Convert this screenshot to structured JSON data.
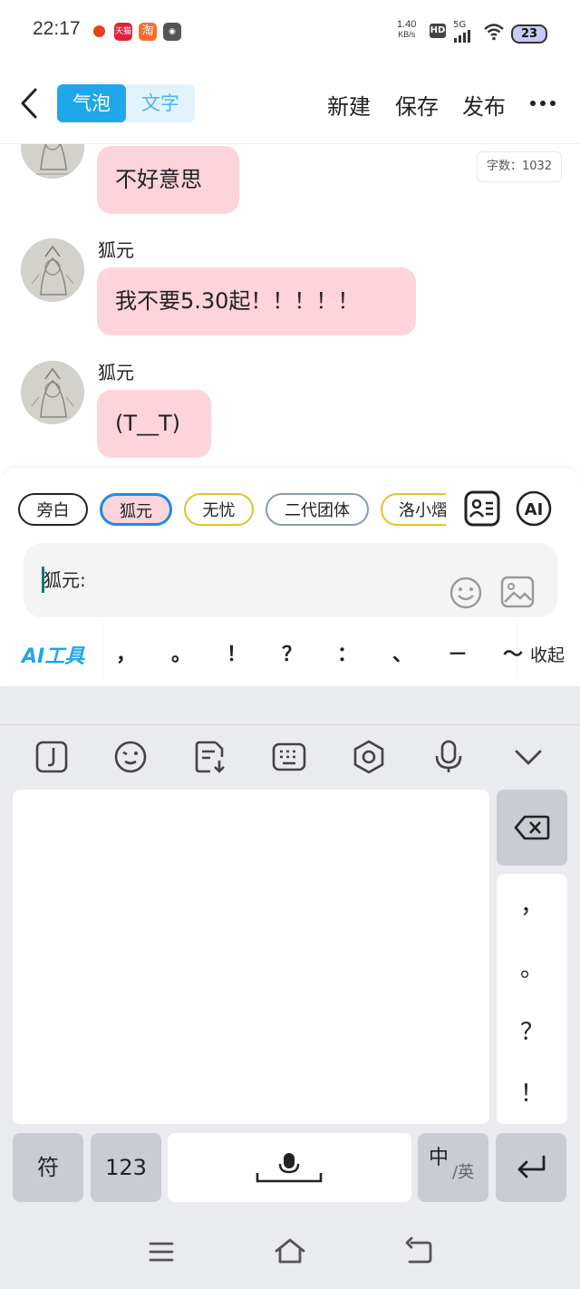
{
  "status_bar": {
    "time": "22:17",
    "apps": [
      "notification-dot",
      "tmall-app",
      "taobao-app",
      "robot-app"
    ],
    "tmall_label": "天猫",
    "taobao_label": "淘",
    "net_speed_value": "1.40",
    "net_speed_unit": "KB/s",
    "hd_label": "HD",
    "signal_label": "5G",
    "battery_level": "23"
  },
  "top_bar": {
    "back_icon": "chevron-left-icon",
    "mode_tabs": [
      "气泡",
      "文字"
    ],
    "selected_mode": "气泡",
    "actions": [
      "新建",
      "保存",
      "发布"
    ],
    "more_icon": "ellipsis-icon"
  },
  "word_count": "字数：1032",
  "messages": [
    {
      "speaker": "",
      "text": "不好意思"
    },
    {
      "speaker": "狐元",
      "text": "我不要5.30起！！！！！"
    },
    {
      "speaker": "狐元",
      "text": "(T__T)"
    }
  ],
  "characters": [
    {
      "name": "旁白",
      "border": "#222222",
      "bg": "#ffffff"
    },
    {
      "name": "狐元",
      "border": "#1e8be0",
      "bg": "#fdd3dc"
    },
    {
      "name": "无忧",
      "border": "#e6c02a",
      "bg": "#ffffff"
    },
    {
      "name": "二代团体",
      "border": "#8a9aaf",
      "bg": "#ffffff"
    },
    {
      "name": "洛小熠",
      "border": "#e6c02a",
      "bg": "#ffffff"
    }
  ],
  "selected_character": "狐元",
  "input": {
    "prompt": "狐元:"
  },
  "ai_tools_label": "AI工具",
  "punctuation": [
    "，",
    "。",
    "！",
    "？",
    "：",
    "、",
    "－",
    "～"
  ],
  "collapse_label": "收起",
  "keyboard": {
    "toolbar_icons": [
      "clipboard-icon",
      "emoji-face-icon",
      "document-edit-icon",
      "keyboard-layout-icon",
      "settings-hex-icon",
      "microphone-icon",
      "chevron-down-icon"
    ],
    "punct_column": [
      "，",
      "。",
      "？",
      "！"
    ],
    "bottom_keys": {
      "symbol": "符",
      "numeric": "123",
      "lang_main": "中",
      "lang_sub": "/英"
    }
  },
  "nav_bar": [
    "menu-icon",
    "home-icon",
    "back-icon"
  ],
  "colors": {
    "accent": "#1ea7ea",
    "bubble": "#fdd3dc",
    "keyboard_bg": "#eaebef"
  }
}
